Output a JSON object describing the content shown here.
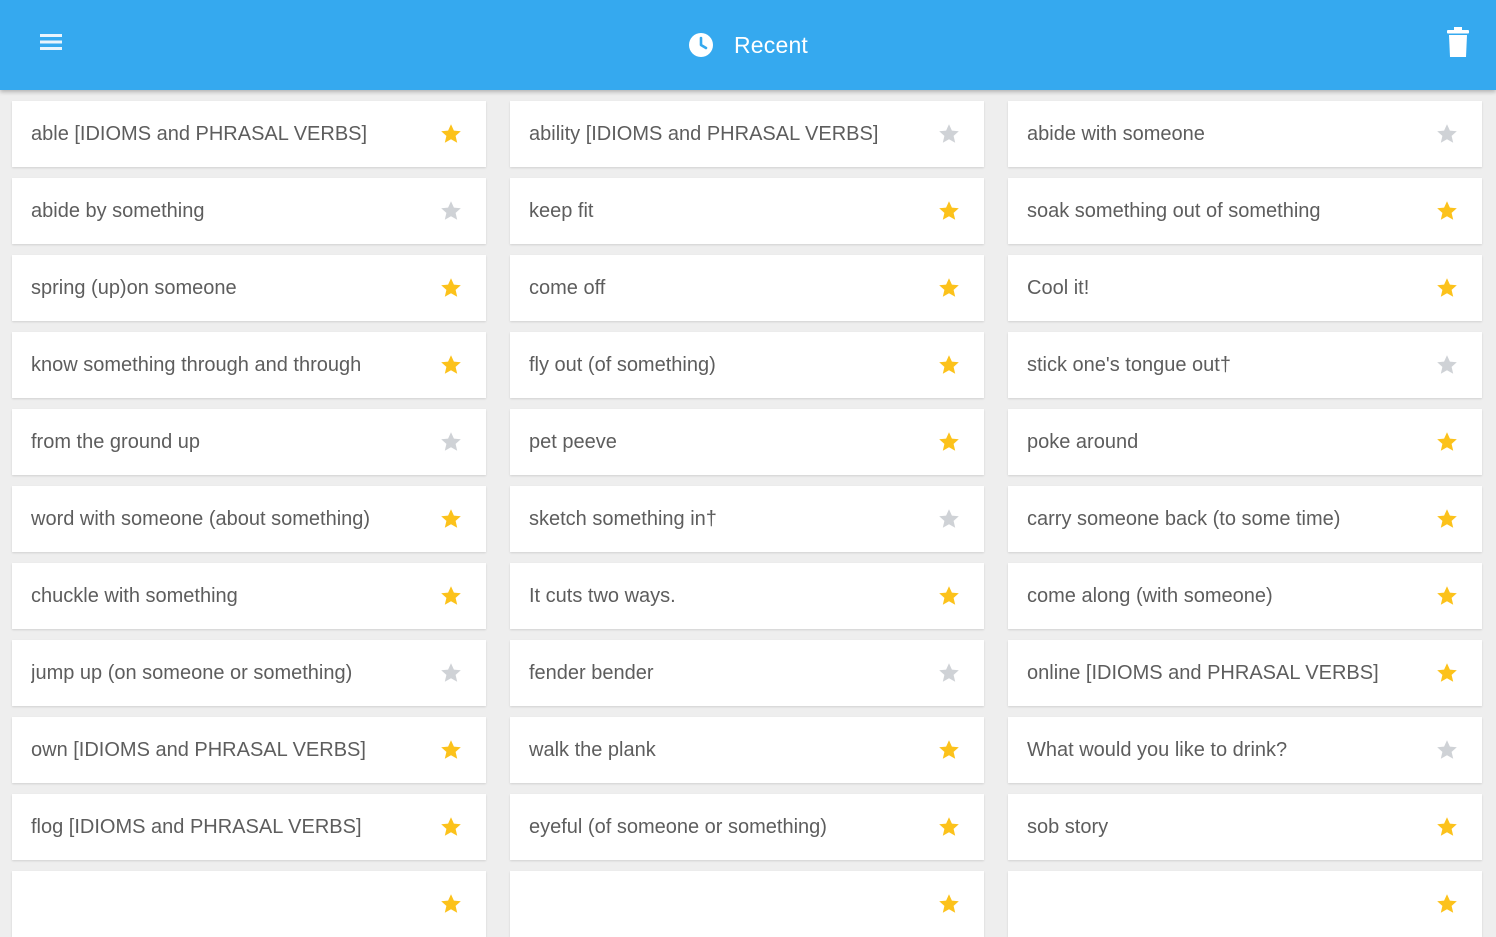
{
  "app_bar": {
    "title": "Recent",
    "title_icon": "clock-icon",
    "menu_icon": "menu-icon",
    "action_icon": "trash-icon",
    "background_color": "#35a9ef"
  },
  "colors": {
    "favorite_star": "#fcc21b",
    "unfavorite_star": "#cfd2d6",
    "item_text": "#5d5d5d",
    "page_background": "#eeeeee"
  },
  "items": [
    {
      "label": "able [IDIOMS and PHRASAL VERBS]",
      "favorite": true
    },
    {
      "label": "ability [IDIOMS and PHRASAL VERBS]",
      "favorite": false
    },
    {
      "label": "abide with someone",
      "favorite": false
    },
    {
      "label": "abide by something",
      "favorite": false
    },
    {
      "label": "keep fit",
      "favorite": true
    },
    {
      "label": "soak something out of something",
      "favorite": true
    },
    {
      "label": "spring (up)on someone",
      "favorite": true
    },
    {
      "label": "come off",
      "favorite": true
    },
    {
      "label": "Cool it!",
      "favorite": true
    },
    {
      "label": "know something through and through",
      "favorite": true
    },
    {
      "label": "fly out (of something)",
      "favorite": true
    },
    {
      "label": "stick one's tongue out†",
      "favorite": false
    },
    {
      "label": "from the ground up",
      "favorite": false
    },
    {
      "label": "pet peeve",
      "favorite": true
    },
    {
      "label": "poke around",
      "favorite": true
    },
    {
      "label": "word with someone (about something)",
      "favorite": true
    },
    {
      "label": "sketch something in†",
      "favorite": false
    },
    {
      "label": "carry someone back (to some time)",
      "favorite": true
    },
    {
      "label": "chuckle with something",
      "favorite": true
    },
    {
      "label": "It cuts two ways.",
      "favorite": true
    },
    {
      "label": "come along (with someone)",
      "favorite": true
    },
    {
      "label": "jump up (on someone or something)",
      "favorite": false
    },
    {
      "label": "fender bender",
      "favorite": false
    },
    {
      "label": "online [IDIOMS and PHRASAL VERBS]",
      "favorite": true
    },
    {
      "label": "own [IDIOMS and PHRASAL VERBS]",
      "favorite": true
    },
    {
      "label": "walk the plank",
      "favorite": true
    },
    {
      "label": "What would you like to drink?",
      "favorite": false
    },
    {
      "label": "flog [IDIOMS and PHRASAL VERBS]",
      "favorite": true
    },
    {
      "label": "eyeful (of someone or something)",
      "favorite": true
    },
    {
      "label": "sob story",
      "favorite": true
    },
    {
      "label": "",
      "favorite": true
    },
    {
      "label": "",
      "favorite": true
    },
    {
      "label": "",
      "favorite": true
    }
  ]
}
